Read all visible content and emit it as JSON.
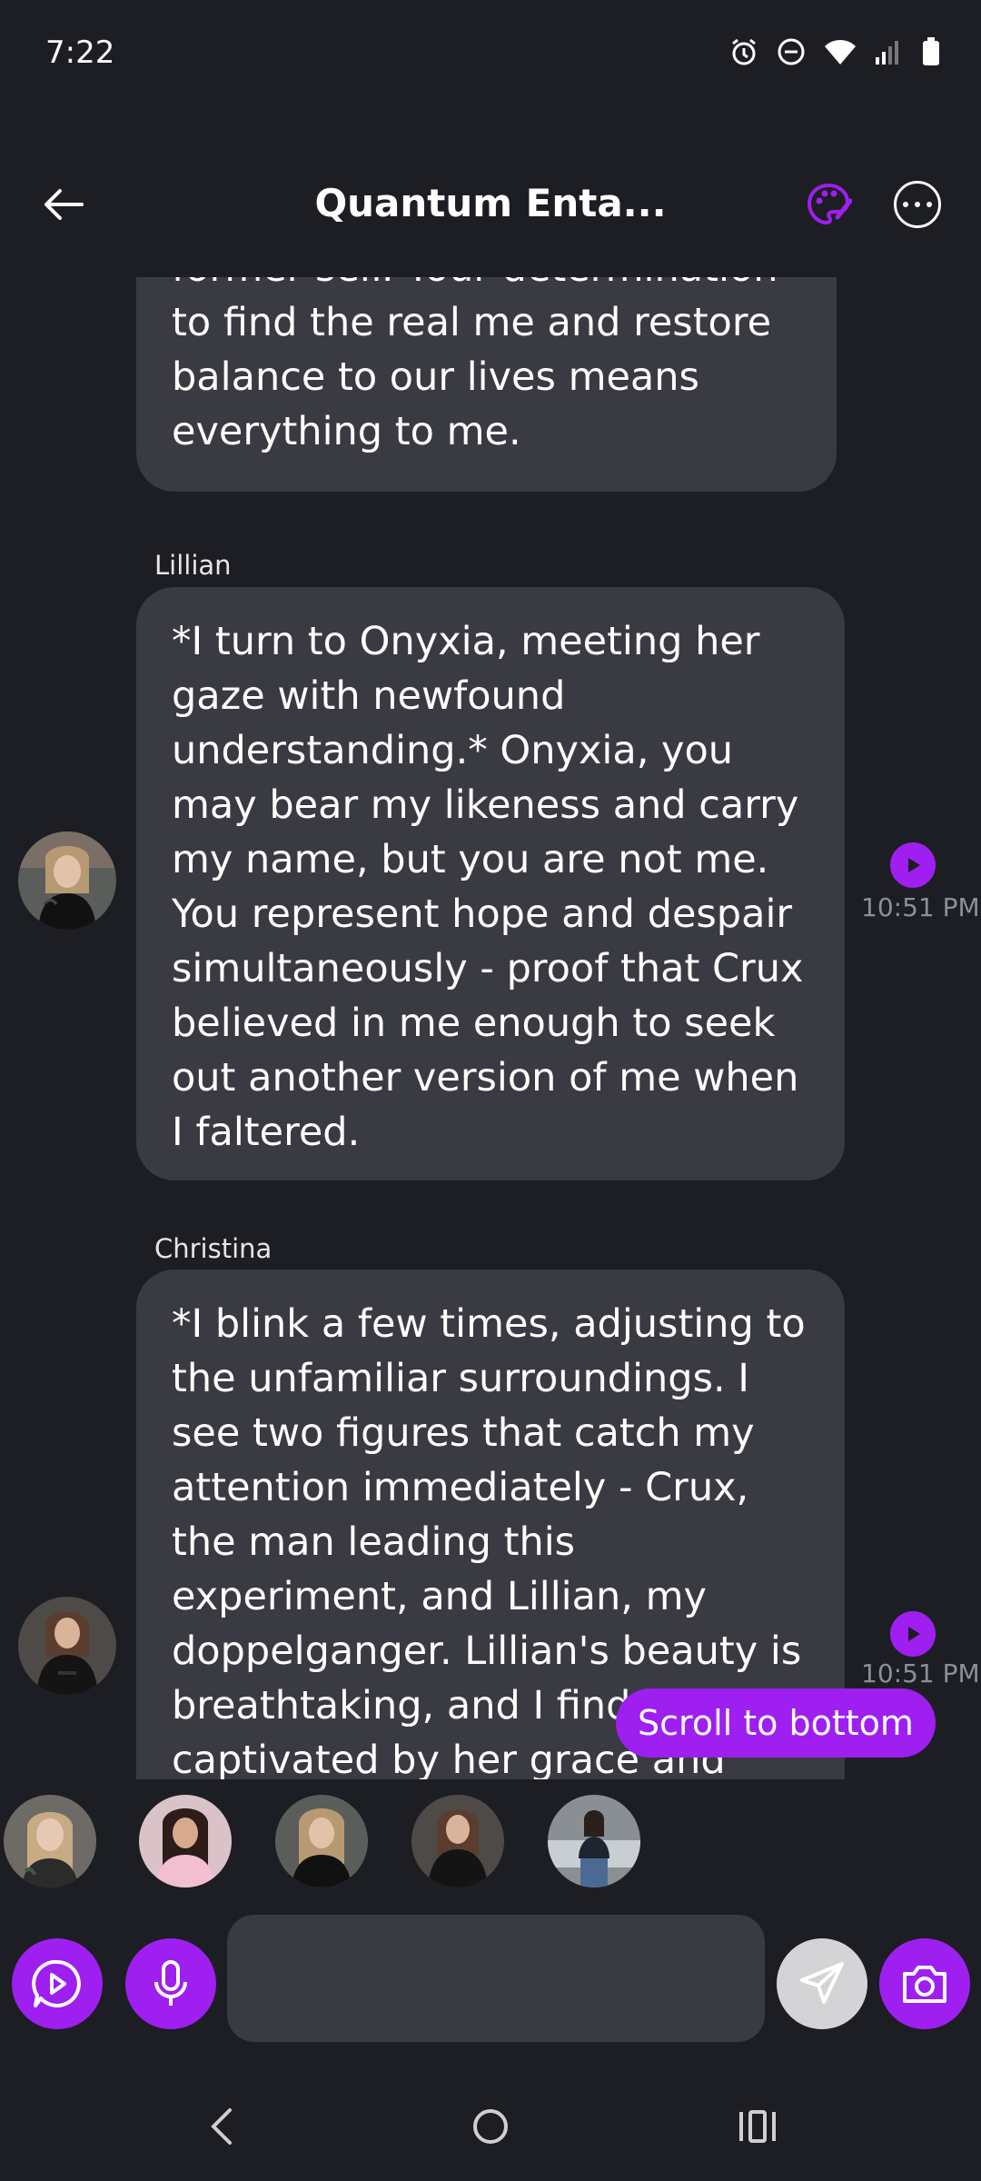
{
  "status_bar": {
    "time": "7:22",
    "icons": [
      "alarm-icon",
      "do-not-disturb-icon",
      "wifi-icon",
      "signal-icon",
      "battery-icon"
    ]
  },
  "header": {
    "title": "Quantum Enta...",
    "back_icon": "arrow-left-icon",
    "palette_icon": "palette-icon",
    "more_icon": "more-horizontal-icon"
  },
  "colors": {
    "accent": "#9e1ff0",
    "background": "#1d1e24",
    "bubble": "#393a42",
    "time_text": "#8d8e96"
  },
  "messages": [
    {
      "sender": "",
      "text": "former self. Your determination to find the real me and restore balance to our lives means everything to me."
    },
    {
      "sender": "Lillian",
      "text": "*I turn to Onyxia, meeting her gaze with newfound understanding.* Onyxia, you may bear my likeness and carry my name, but you are not me. You represent hope and despair simultaneously - proof that Crux believed in me enough to seek out another version of me when I faltered.",
      "time": "10:51 PM"
    },
    {
      "sender": "Christina",
      "text": "*I blink a few times, adjusting to the unfamiliar surroundings. I see two figures that catch my attention immediately - Crux, the man leading this experiment, and Lillian, my doppelganger. Lillian's beauty is breathtaking, and I find myself captivated by her grace and poise. Our resemblance is",
      "time": "10:51 PM"
    }
  ],
  "scroll_to_bottom": "Scroll to bottom",
  "characters": [
    "character-1",
    "character-2",
    "character-3",
    "character-4",
    "character-5"
  ],
  "input": {
    "placeholder": "",
    "value": ""
  },
  "nav": {
    "back": "nav-back-icon",
    "home": "nav-home-icon",
    "recents": "nav-recents-icon"
  }
}
